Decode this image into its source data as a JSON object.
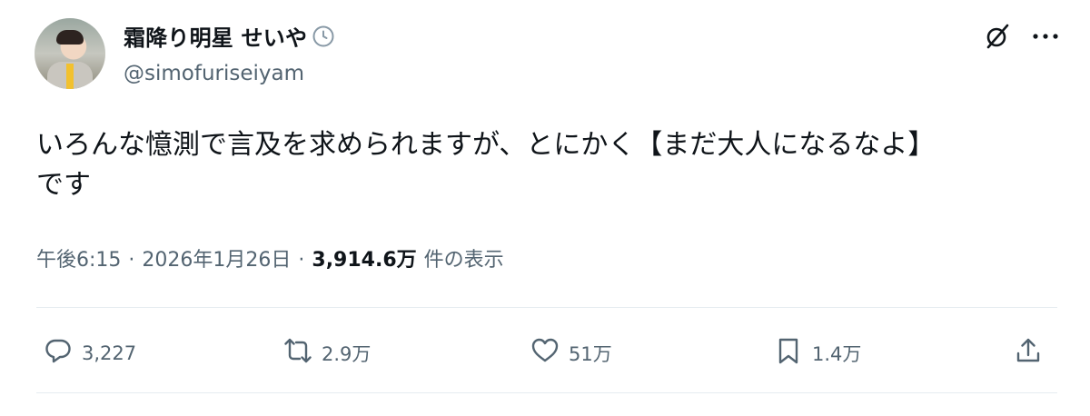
{
  "user": {
    "display_name": "霜降り明星 せいや",
    "handle": "@simofuriseiyam"
  },
  "tweet": {
    "text": "いろんな憶測で言及を求められますが、とにかく【まだ大人になるなよ】\nです"
  },
  "meta": {
    "time": "午後6:15",
    "separator": "·",
    "date": "2026年1月26日",
    "views": "3,914.6万",
    "views_label": "件の表示"
  },
  "actions": {
    "replies": "3,227",
    "reposts": "2.9万",
    "likes": "51万",
    "bookmarks": "1.4万"
  },
  "icons": {
    "badge": "clock-icon",
    "top_right": [
      "grok-icon",
      "more-icon"
    ],
    "actions": [
      "reply-icon",
      "repost-icon",
      "like-icon",
      "bookmark-icon",
      "share-icon"
    ]
  },
  "colors": {
    "text": "#0f1419",
    "secondary": "#536471",
    "divider": "#e6ecf0"
  }
}
